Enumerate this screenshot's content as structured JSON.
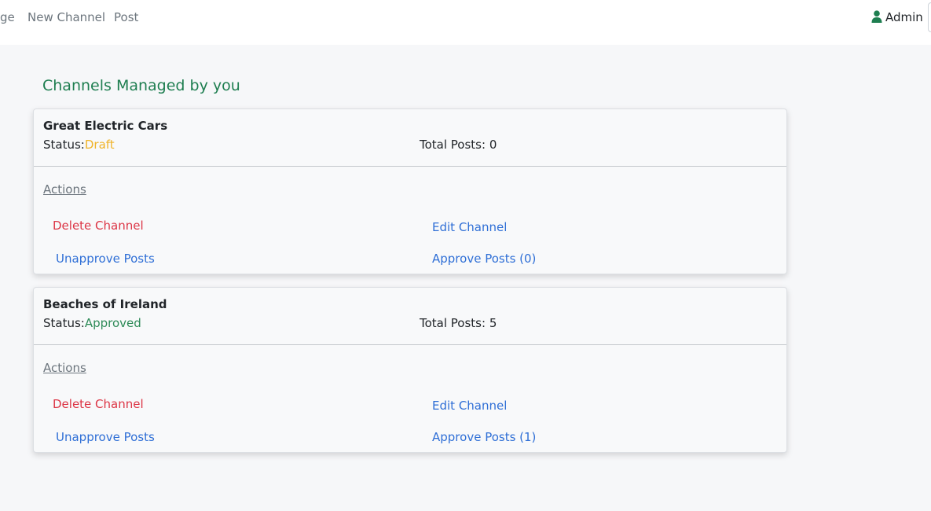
{
  "nav": {
    "links": [
      "ge",
      "New Channel",
      "Post"
    ],
    "user": "Admin"
  },
  "page": {
    "title": "Channels Managed by you"
  },
  "channels": [
    {
      "name": "Great Electric Cars",
      "status_label": "Status:",
      "status": "Draft",
      "total_posts": "Total Posts: 0",
      "actions_label": "Actions",
      "delete": "Delete Channel",
      "edit": "Edit Channel",
      "unapprove": "Unapprove Posts",
      "approve": "Approve Posts (0)"
    },
    {
      "name": "Beaches of Ireland",
      "status_label": "Status:",
      "status": "Approved",
      "total_posts": "Total Posts: 5",
      "actions_label": "Actions",
      "delete": "Delete Channel",
      "edit": "Edit Channel",
      "unapprove": "Unapprove Posts",
      "approve": "Approve Posts (1)"
    }
  ],
  "colors": {
    "title": "#1e7e50",
    "draft": "#f0b429",
    "approved": "#2d8a57",
    "delete": "#dc3545",
    "link": "#2f6fd6"
  },
  "icons": {
    "user": "user-icon"
  }
}
